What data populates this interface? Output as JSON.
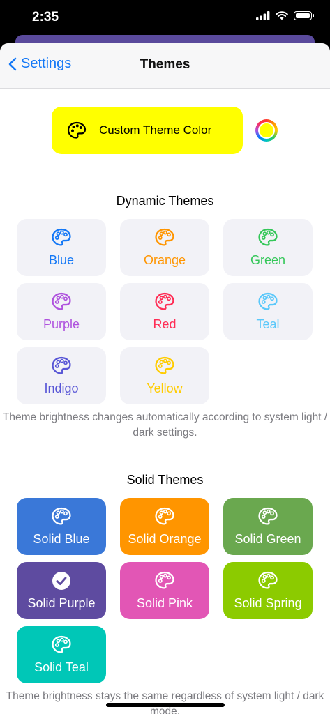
{
  "status": {
    "time": "2:35"
  },
  "nav": {
    "back_label": "Settings",
    "title": "Themes"
  },
  "custom": {
    "label": "Custom Theme Color",
    "color": "#FFFF00"
  },
  "dynamic": {
    "title": "Dynamic Themes",
    "items": [
      {
        "label": "Blue",
        "color": "#1478F6"
      },
      {
        "label": "Orange",
        "color": "#FF9500"
      },
      {
        "label": "Green",
        "color": "#34C759"
      },
      {
        "label": "Purple",
        "color": "#AF52DE"
      },
      {
        "label": "Red",
        "color": "#FF2D55"
      },
      {
        "label": "Teal",
        "color": "#5AC8FA"
      },
      {
        "label": "Indigo",
        "color": "#5856D6"
      },
      {
        "label": "Yellow",
        "color": "#FFCC00"
      }
    ],
    "note": "Theme brightness changes automatically according to system light / dark settings."
  },
  "solid": {
    "title": "Solid Themes",
    "items": [
      {
        "label": "Solid Blue",
        "color": "#3A78D8",
        "selected": false
      },
      {
        "label": "Solid Orange",
        "color": "#FF9500",
        "selected": false
      },
      {
        "label": "Solid Green",
        "color": "#6AA84F",
        "selected": false
      },
      {
        "label": "Solid Purple",
        "color": "#5E4BA0",
        "selected": true
      },
      {
        "label": "Solid Pink",
        "color": "#E256B5",
        "selected": false
      },
      {
        "label": "Solid Spring",
        "color": "#8CCB00",
        "selected": false
      },
      {
        "label": "Solid Teal",
        "color": "#00C7B7",
        "selected": false
      }
    ],
    "note": "Theme brightness stays the same regardless of system light / dark mode."
  }
}
